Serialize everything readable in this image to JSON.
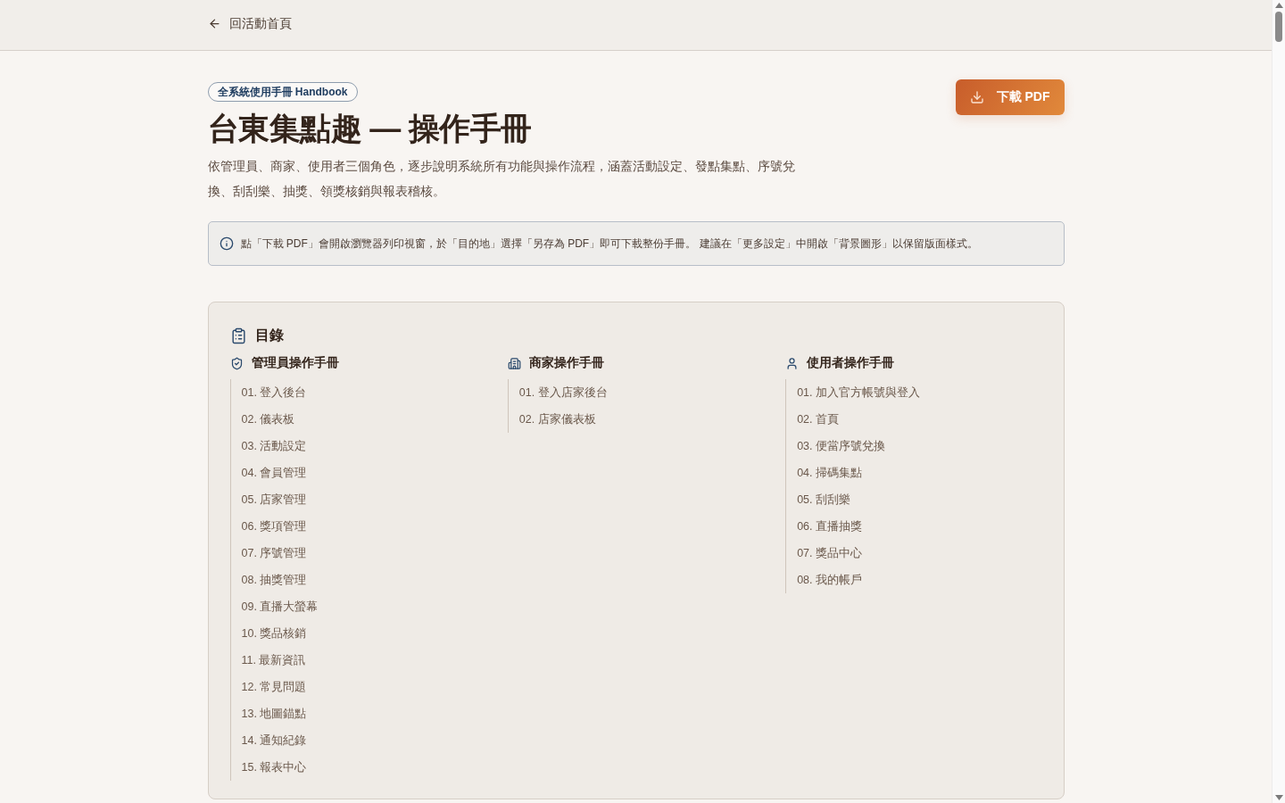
{
  "nav": {
    "back_label": "回活動首頁"
  },
  "hero": {
    "badge": "全系統使用手冊 Handbook",
    "title": "台東集點趣 — 操作手冊",
    "description": "依管理員、商家、使用者三個角色，逐步說明系統所有功能與操作流程，涵蓋活動設定、發點集點、序號兌換、刮刮樂、抽獎、領獎核銷與報表稽核。",
    "download_button": "下載 PDF"
  },
  "notice": {
    "text": "點「下載 PDF」會開啟瀏覽器列印視窗，於「目的地」選擇「另存為 PDF」即可下載整份手冊。 建議在「更多設定」中開啟「背景圖形」以保留版面樣式。"
  },
  "toc": {
    "title": "目錄",
    "sections": [
      {
        "kind": "admin",
        "title": "管理員操作手冊",
        "items": [
          "01. 登入後台",
          "02. 儀表板",
          "03. 活動設定",
          "04. 會員管理",
          "05. 店家管理",
          "06. 獎項管理",
          "07. 序號管理",
          "08. 抽獎管理",
          "09. 直播大螢幕",
          "10. 獎品核銷",
          "11. 最新資訊",
          "12. 常見問題",
          "13. 地圖錨點",
          "14. 通知紀錄",
          "15. 報表中心"
        ]
      },
      {
        "kind": "merchant",
        "title": "商家操作手冊",
        "items": [
          "01. 登入店家後台",
          "02. 店家儀表板"
        ]
      },
      {
        "kind": "user",
        "title": "使用者操作手冊",
        "items": [
          "01. 加入官方帳號與登入",
          "02. 首頁",
          "03. 便當序號兌換",
          "04. 掃碼集點",
          "05. 刮刮樂",
          "06. 直播抽獎",
          "07. 獎品中心",
          "08. 我的帳戶"
        ]
      }
    ]
  }
}
